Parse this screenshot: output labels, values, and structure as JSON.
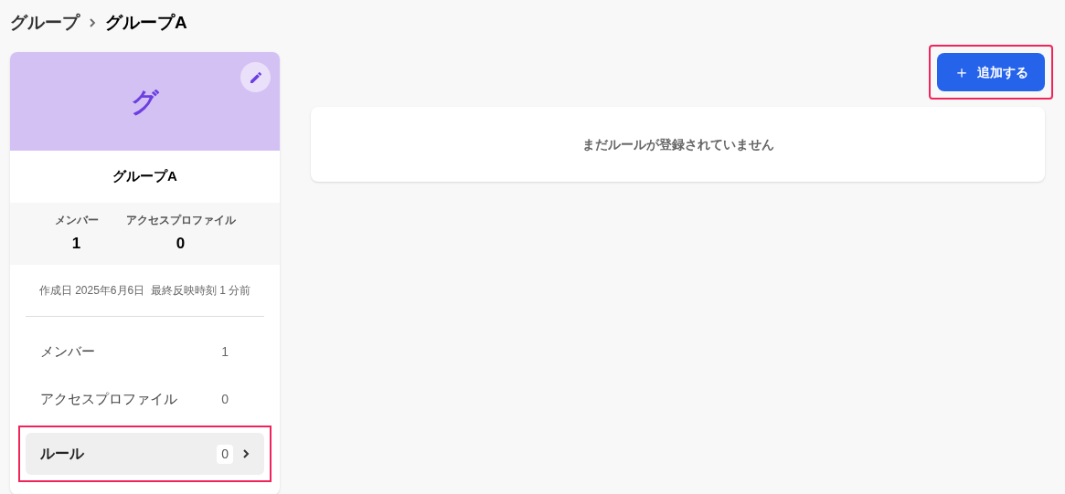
{
  "breadcrumb": [
    {
      "label": "グループ"
    },
    {
      "label": "グループA"
    }
  ],
  "group": {
    "initial": "グ",
    "name": "グループA",
    "stats": [
      {
        "label": "メンバー",
        "value": "1"
      },
      {
        "label": "アクセスプロファイル",
        "value": "0"
      }
    ],
    "meta": "作成日 2025年6月6日  最終反映時刻 1 分前"
  },
  "nav": [
    {
      "label": "メンバー",
      "count": "1",
      "selected": false,
      "highlighted": false
    },
    {
      "label": "アクセスプロファイル",
      "count": "0",
      "selected": false,
      "highlighted": false
    },
    {
      "label": "ルール",
      "count": "0",
      "selected": true,
      "highlighted": true
    }
  ],
  "add_button": {
    "icon": "＋",
    "label": "追加する",
    "highlighted": true
  },
  "empty_message": "まだルールが登録されていません"
}
